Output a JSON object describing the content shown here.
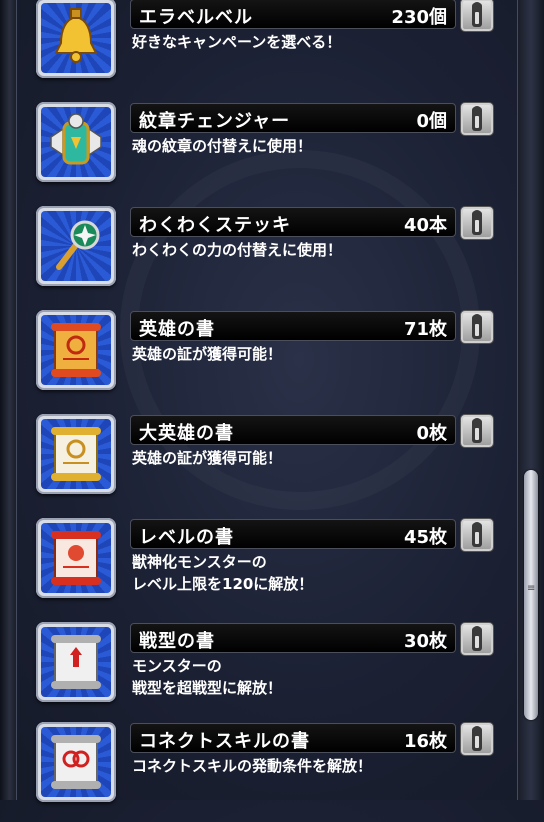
{
  "items": [
    {
      "name": "エラベルベル",
      "count": "230個",
      "desc": "好きなキャンペーンを選べる！",
      "icon": "bell-icon"
    },
    {
      "name": "紋章チェンジャー",
      "count": "0個",
      "desc": "魂の紋章の付替えに使用！",
      "icon": "crest-changer-icon"
    },
    {
      "name": "わくわくステッキ",
      "count": "40本",
      "desc": "わくわくの力の付替えに使用！",
      "icon": "wand-icon"
    },
    {
      "name": "英雄の書",
      "count": "71枚",
      "desc": "英雄の証が獲得可能！",
      "icon": "hero-scroll-icon"
    },
    {
      "name": "大英雄の書",
      "count": "0枚",
      "desc": "英雄の証が獲得可能！",
      "icon": "great-hero-scroll-icon"
    },
    {
      "name": "レベルの書",
      "count": "45枚",
      "desc": "獣神化モンスターの\nレベル上限を120に解放！",
      "icon": "level-scroll-icon"
    },
    {
      "name": "戦型の書",
      "count": "30枚",
      "desc": "モンスターの\n戦型を超戦型に解放！",
      "icon": "combat-type-scroll-icon"
    },
    {
      "name": "コネクトスキルの書",
      "count": "16枚",
      "desc": "コネクトスキルの発動条件を解放！",
      "icon": "connect-skill-scroll-icon"
    }
  ],
  "colors": {
    "icon_bg": "#2a5ad6",
    "bar_bg": "#000000",
    "text": "#ffffff"
  }
}
